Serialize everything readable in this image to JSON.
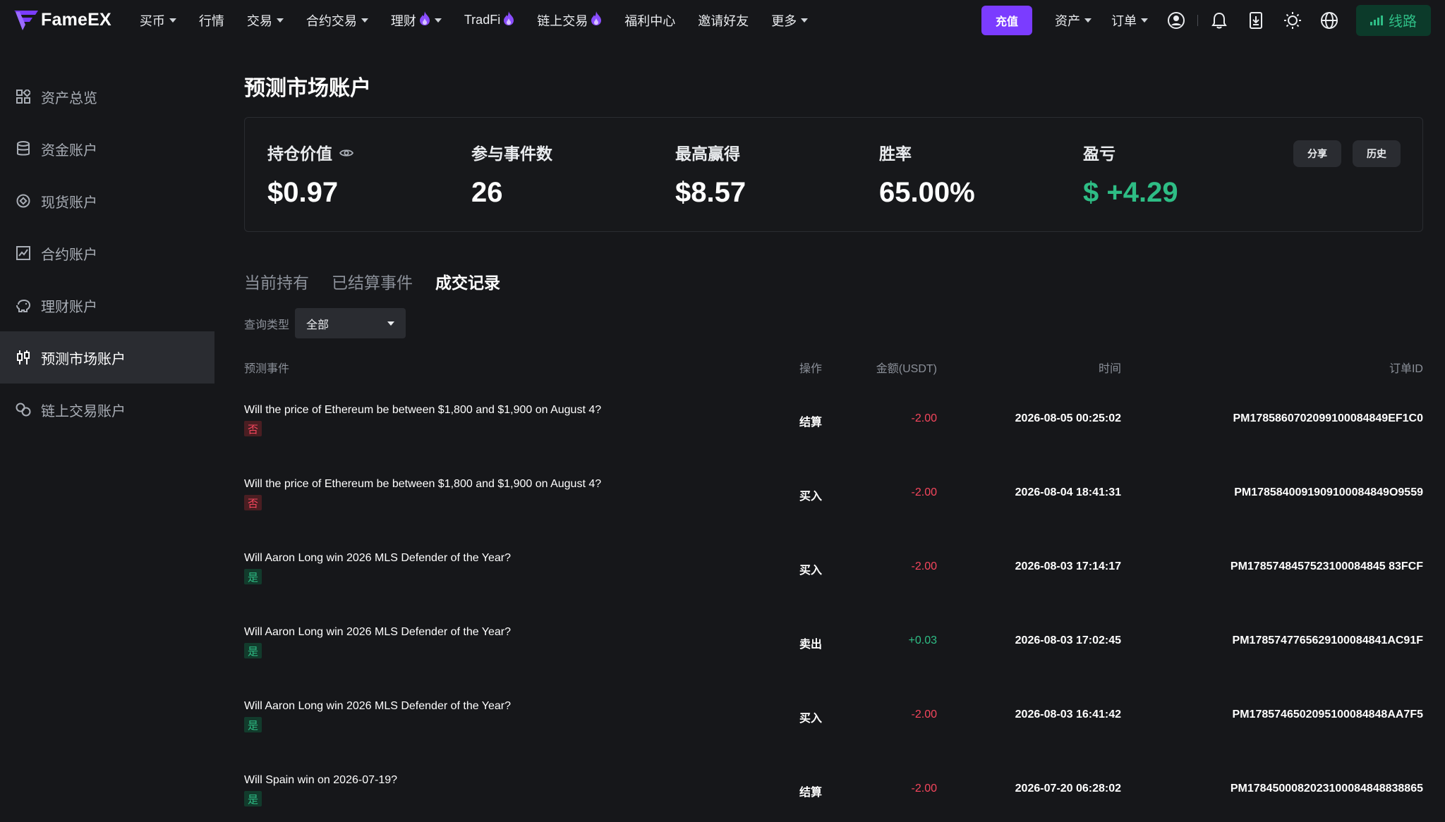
{
  "brand": {
    "name": "FameEX"
  },
  "nav": {
    "items": [
      {
        "label": "买币",
        "dropdown": true,
        "fire": false
      },
      {
        "label": "行情",
        "dropdown": false,
        "fire": false
      },
      {
        "label": "交易",
        "dropdown": true,
        "fire": false
      },
      {
        "label": "合约交易",
        "dropdown": true,
        "fire": false
      },
      {
        "label": "理财",
        "dropdown": true,
        "fire": true
      },
      {
        "label": "TradFi",
        "dropdown": false,
        "fire": true
      },
      {
        "label": "链上交易",
        "dropdown": false,
        "fire": true
      },
      {
        "label": "福利中心",
        "dropdown": false,
        "fire": false
      },
      {
        "label": "邀请好友",
        "dropdown": false,
        "fire": false
      },
      {
        "label": "更多",
        "dropdown": true,
        "fire": false
      }
    ],
    "deposit": "充值",
    "assets": "资产",
    "orders": "订单",
    "line": "线路"
  },
  "sidebar": {
    "items": [
      {
        "label": "资产总览",
        "icon": "grid-icon",
        "active": false
      },
      {
        "label": "资金账户",
        "icon": "database-icon",
        "active": false
      },
      {
        "label": "现货账户",
        "icon": "spot-icon",
        "active": false
      },
      {
        "label": "合约账户",
        "icon": "futures-chart-icon",
        "active": false
      },
      {
        "label": "理财账户",
        "icon": "piggy-bank-icon",
        "active": false
      },
      {
        "label": "预测市场账户",
        "icon": "candlestick-icon",
        "active": true
      },
      {
        "label": "链上交易账户",
        "icon": "onchain-icon",
        "active": false
      }
    ]
  },
  "page": {
    "title": "预测市场账户"
  },
  "stats": {
    "position_value": {
      "label": "持仓价值",
      "value": "$0.97"
    },
    "events": {
      "label": "参与事件数",
      "value": "26"
    },
    "max_win": {
      "label": "最高赢得",
      "value": "$8.57"
    },
    "win_rate": {
      "label": "胜率",
      "value": "65.00%"
    },
    "pnl": {
      "label": "盈亏",
      "value": "$ +4.29"
    },
    "share": "分享",
    "history": "历史"
  },
  "tabs": [
    {
      "label": "当前持有",
      "active": false
    },
    {
      "label": "已结算事件",
      "active": false
    },
    {
      "label": "成交记录",
      "active": true
    }
  ],
  "filter": {
    "label": "查询类型",
    "value": "全部"
  },
  "table": {
    "headers": {
      "event": "预测事件",
      "op": "操作",
      "amount": "金额(USDT)",
      "time": "时间",
      "order_id": "订单ID"
    },
    "rows": [
      {
        "event": "Will the price of Ethereum be between $1,800 and $1,900 on August 4?",
        "tag": "否",
        "tag_type": "no",
        "op": "结算",
        "amount": "-2.00",
        "amount_type": "neg",
        "time": "2026-08-05 00:25:02",
        "order_id": "PM1785860702099100084849EF1C0"
      },
      {
        "event": "Will the price of Ethereum be between $1,800 and $1,900 on August 4?",
        "tag": "否",
        "tag_type": "no",
        "op": "买入",
        "amount": "-2.00",
        "amount_type": "neg",
        "time": "2026-08-04 18:41:31",
        "order_id": "PM1785840091909100084849O9559"
      },
      {
        "event": "Will Aaron Long win 2026 MLS Defender of the Year?",
        "tag": "是",
        "tag_type": "yes",
        "op": "买入",
        "amount": "-2.00",
        "amount_type": "neg",
        "time": "2026-08-03 17:14:17",
        "order_id": "PM1785748457523100084845 83FCF"
      },
      {
        "event": "Will Aaron Long win 2026 MLS Defender of the Year?",
        "tag": "是",
        "tag_type": "yes",
        "op": "卖出",
        "amount": "+0.03",
        "amount_type": "pos",
        "time": "2026-08-03 17:02:45",
        "order_id": "PM1785747765629100084841AC91F"
      },
      {
        "event": "Will Aaron Long win 2026 MLS Defender of the Year?",
        "tag": "是",
        "tag_type": "yes",
        "op": "买入",
        "amount": "-2.00",
        "amount_type": "neg",
        "time": "2026-08-03 16:41:42",
        "order_id": "PM1785746502095100084848AA7F5"
      },
      {
        "event": "Will Spain win on 2026-07-19?",
        "tag": "是",
        "tag_type": "yes",
        "op": "结算",
        "amount": "-2.00",
        "amount_type": "neg",
        "time": "2026-07-20 06:28:02",
        "order_id": "PM1784500082023100084848838865"
      }
    ]
  },
  "colors": {
    "accent": "#7b3cff",
    "positive": "#2ebd85",
    "negative": "#f6465d",
    "background": "#16171a"
  }
}
